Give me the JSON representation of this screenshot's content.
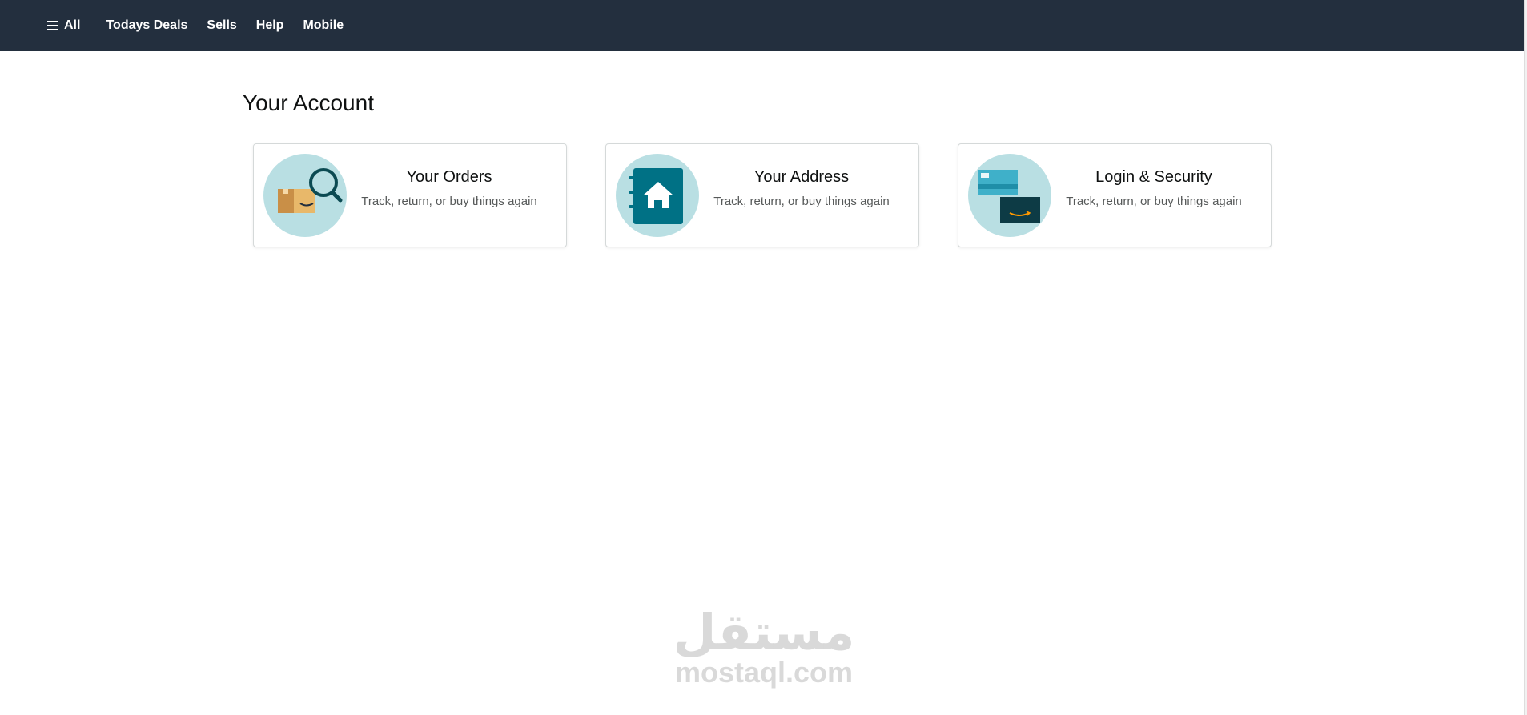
{
  "nav": {
    "items": [
      {
        "label": "All"
      },
      {
        "label": "Todays Deals"
      },
      {
        "label": "Sells"
      },
      {
        "label": "Help"
      },
      {
        "label": "Mobile"
      }
    ]
  },
  "page": {
    "title": "Your Account"
  },
  "cards": [
    {
      "title": "Your Orders",
      "desc": "Track, return, or buy things again",
      "icon": "orders-box-magnifier-icon"
    },
    {
      "title": "Your Address",
      "desc": "Track, return, or buy things again",
      "icon": "address-book-home-icon"
    },
    {
      "title": "Login & Security",
      "desc": "Track, return, or buy things again",
      "icon": "login-security-cards-icon"
    }
  ],
  "watermark": {
    "arabic": "مستقل",
    "latin": "mostaql.com"
  },
  "colors": {
    "navbar": "#232f3e",
    "icon_circle": "#b9dfe3",
    "accent_teal": "#007185",
    "accent_orange": "#ff9900"
  }
}
